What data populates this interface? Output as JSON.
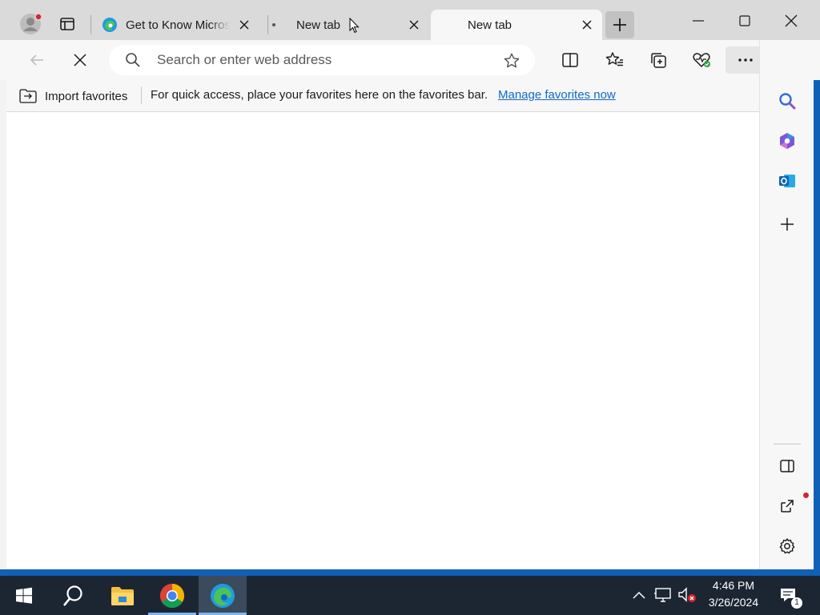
{
  "tabs": [
    {
      "title": "Get to Know Micros"
    },
    {
      "title": "New tab"
    },
    {
      "title": "New tab"
    }
  ],
  "address_bar": {
    "placeholder": "Search or enter web address",
    "value": ""
  },
  "favorites_bar": {
    "import_label": "Import favorites",
    "message": "For quick access, place your favorites here on the favorites bar.",
    "manage_link": "Manage favorites now"
  },
  "taskbar": {
    "time": "4:46 PM",
    "date": "3/26/2024",
    "notification_count": "1"
  },
  "colors": {
    "accent_link": "#0e69c9",
    "taskbar": "#1c2633",
    "desktop": "#1160b7"
  },
  "icons": [
    "profile-icon",
    "tab-actions-icon",
    "edge-icon",
    "close-icon",
    "new-tab-icon",
    "minimize-icon",
    "maximize-icon",
    "back-icon",
    "stop-icon",
    "search-icon",
    "favorite-star-icon",
    "split-screen-icon",
    "favorites-icon",
    "collections-icon",
    "browser-essentials-icon",
    "more-icon",
    "copilot-icon",
    "sidebar-search-icon",
    "office-icon",
    "outlook-icon",
    "add-icon",
    "hide-sidebar-icon",
    "external-link-icon",
    "settings-icon",
    "windows-start-icon",
    "taskbar-search-icon",
    "file-explorer-icon",
    "chrome-icon",
    "chevron-up-icon",
    "network-icon",
    "volume-muted-icon",
    "notifications-icon"
  ]
}
